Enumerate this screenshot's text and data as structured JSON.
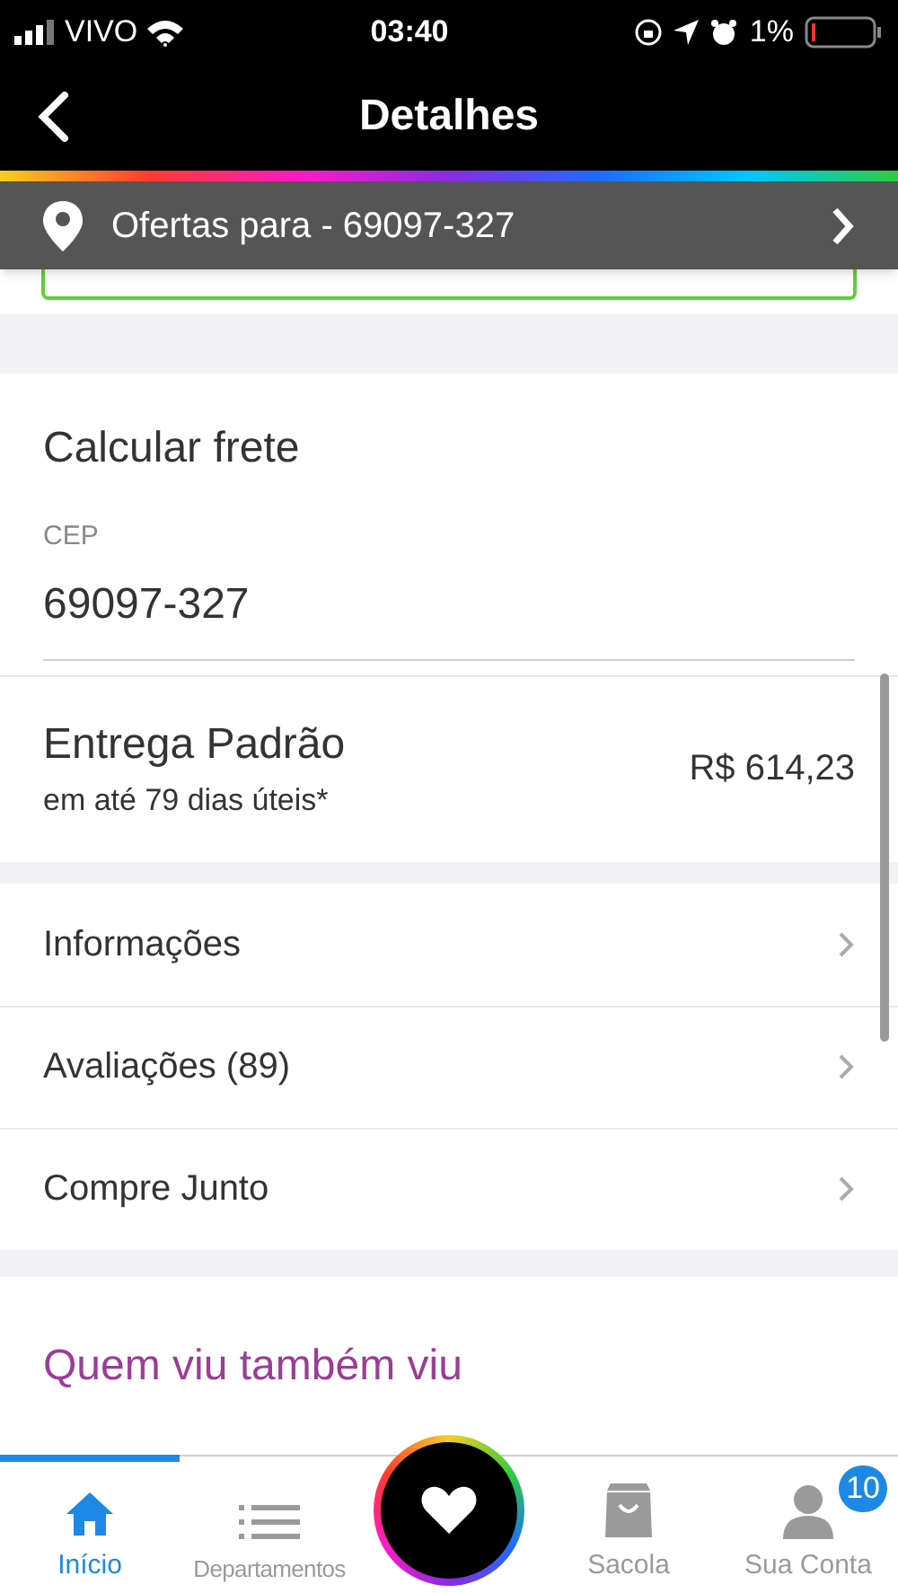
{
  "status_bar": {
    "carrier": "VIVO",
    "time": "03:40",
    "battery": "1%"
  },
  "header": {
    "title": "Detalhes"
  },
  "location_bar": {
    "label": "Ofertas para - 69097-327"
  },
  "shipping": {
    "title": "Calcular frete",
    "field_label": "CEP",
    "field_value": "69097-327",
    "option_name": "Entrega Padrão",
    "option_time": "em até 79 dias úteis*",
    "option_price": "R$ 614,23"
  },
  "menu": [
    {
      "label": "Informações"
    },
    {
      "label": "Avaliações (89)"
    },
    {
      "label": "Compre Junto"
    }
  ],
  "related": {
    "title": "Quem viu também viu"
  },
  "tab_bar": [
    {
      "kind": "home",
      "label": "Início",
      "selected": true
    },
    {
      "kind": "list",
      "label": "Departamentos",
      "selected": false
    },
    {
      "kind": "heart",
      "selected": false
    },
    {
      "kind": "bag",
      "label": "Sacola",
      "selected": false
    },
    {
      "kind": "account",
      "label": "Sua Conta",
      "badge": "10",
      "selected": false
    }
  ]
}
